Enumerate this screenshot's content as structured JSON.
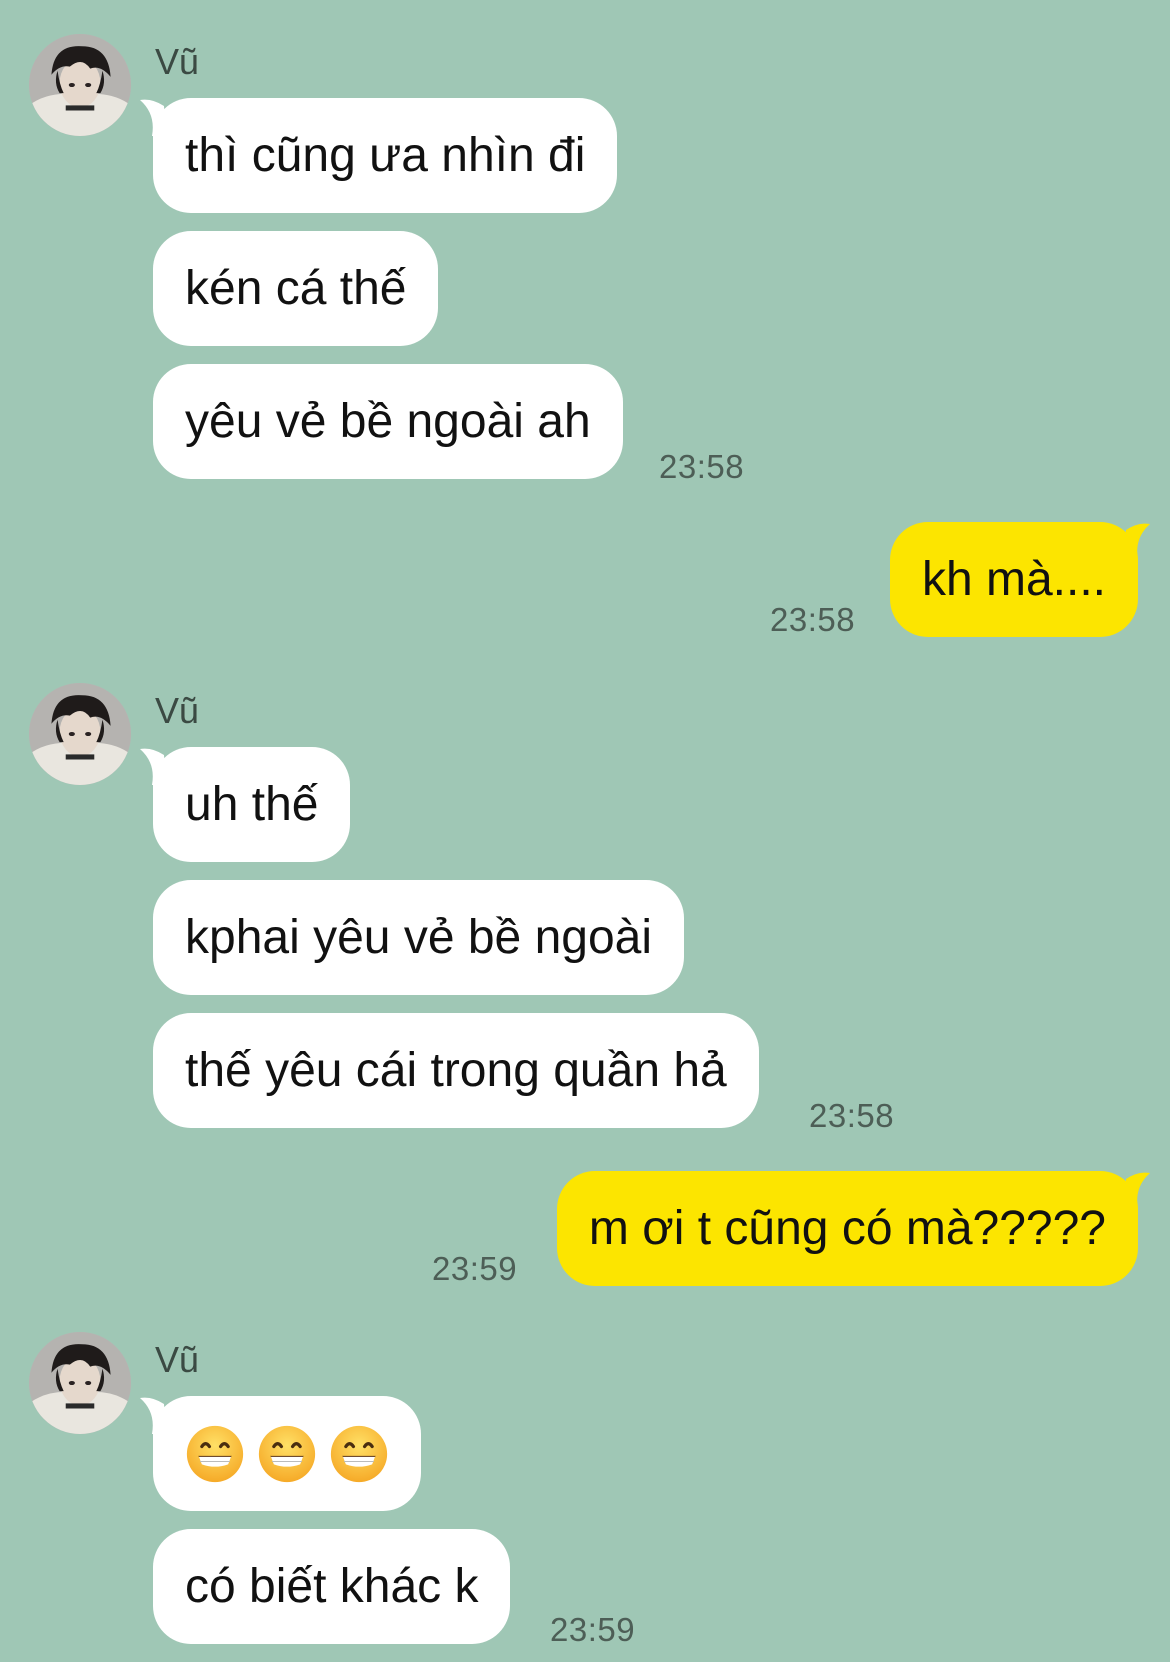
{
  "colors": {
    "background": "#9FC7B5",
    "incoming_bubble": "#FFFFFF",
    "outgoing_bubble": "#FCE500",
    "timestamp_text": "#4D5E56"
  },
  "messages": {
    "group1": {
      "sender": "Vũ",
      "avatar_icon": "avatar-icon",
      "bubbles": [
        "thì cũng ưa nhìn đi",
        "kén cá thế",
        "yêu vẻ bề ngoài ah"
      ],
      "time": "23:58"
    },
    "out1": {
      "text": "kh mà....",
      "time": "23:58"
    },
    "group2": {
      "sender": "Vũ",
      "avatar_icon": "avatar-icon",
      "bubbles": [
        "uh thế",
        "kphai yêu vẻ bề ngoài",
        "thế yêu cái trong quần hả"
      ],
      "time": "23:58"
    },
    "out2": {
      "text": "m ơi t cũng có mà?????",
      "time": "23:59"
    },
    "group3": {
      "sender": "Vũ",
      "avatar_icon": "avatar-icon",
      "emoji_count": 3,
      "emoji_icon": "grinning-face-emoji-icon",
      "bubbles": [
        "có biết khác k"
      ],
      "time": "23:59"
    }
  }
}
